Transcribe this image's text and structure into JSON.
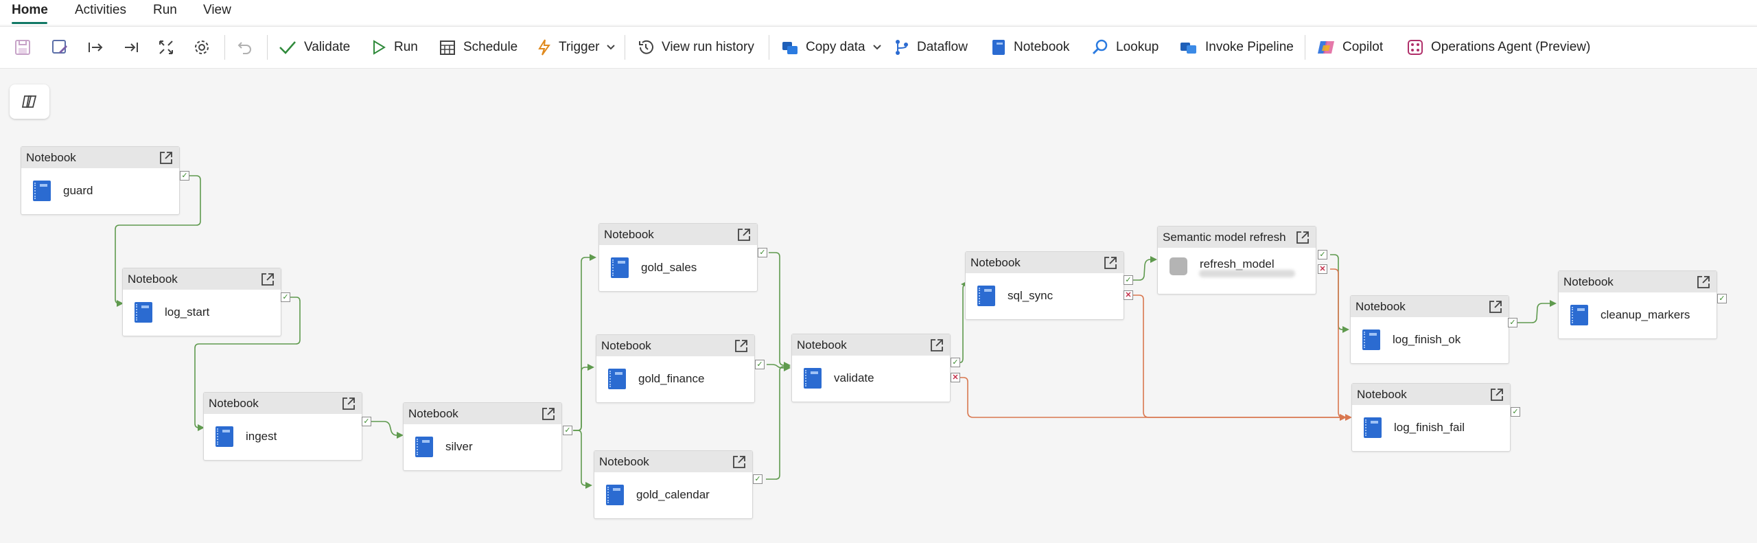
{
  "tabs": [
    {
      "label": "Home",
      "active": true
    },
    {
      "label": "Activities"
    },
    {
      "label": "Run"
    },
    {
      "label": "View"
    }
  ],
  "toolbar": {
    "validate": "Validate",
    "run": "Run",
    "schedule": "Schedule",
    "trigger": "Trigger",
    "view_run_history": "View run history",
    "copy_data": "Copy data",
    "dataflow": "Dataflow",
    "notebook": "Notebook",
    "lookup": "Lookup",
    "invoke_pipeline": "Invoke Pipeline",
    "copilot": "Copilot",
    "operations_agent": "Operations Agent (Preview)"
  },
  "nodes": {
    "guard": {
      "type": "Notebook",
      "name": "guard"
    },
    "log_start": {
      "type": "Notebook",
      "name": "log_start"
    },
    "ingest": {
      "type": "Notebook",
      "name": "ingest"
    },
    "silver": {
      "type": "Notebook",
      "name": "silver"
    },
    "gold_sales": {
      "type": "Notebook",
      "name": "gold_sales"
    },
    "gold_finance": {
      "type": "Notebook",
      "name": "gold_finance"
    },
    "gold_calendar": {
      "type": "Notebook",
      "name": "gold_calendar"
    },
    "validate": {
      "type": "Notebook",
      "name": "validate"
    },
    "sql_sync": {
      "type": "Notebook",
      "name": "sql_sync"
    },
    "refresh_model": {
      "type": "Semantic model refresh",
      "name": "refresh_model"
    },
    "log_finish_ok": {
      "type": "Notebook",
      "name": "log_finish_ok"
    },
    "log_finish_fail": {
      "type": "Notebook",
      "name": "log_finish_fail"
    },
    "cleanup_markers": {
      "type": "Notebook",
      "name": "cleanup_markers"
    }
  },
  "colors": {
    "success_edge": "#5f9a4e",
    "fail_edge": "#d9774f",
    "accent": "#117865"
  }
}
